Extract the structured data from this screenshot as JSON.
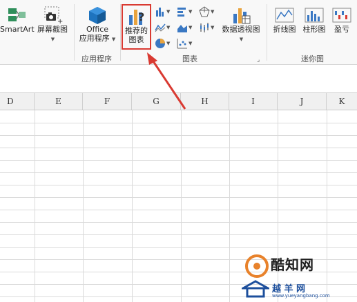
{
  "ribbon": {
    "smartart_label": "SmartArt",
    "screenshot_label": "屏幕截图",
    "office_apps_line1": "Office",
    "office_apps_line2": "应用程序",
    "group_apps_label": "应用程序",
    "recommended_charts_line1": "推荐的",
    "recommended_charts_line2": "图表",
    "pivot_chart_label": "数据透视图",
    "group_charts_label": "图表",
    "spark_line_label": "折线图",
    "spark_column_label": "柱形图",
    "spark_winloss_label": "盈亏",
    "group_sparklines_label": "迷你图"
  },
  "columns": [
    "D",
    "E",
    "F",
    "G",
    "H",
    "I",
    "J",
    "K"
  ],
  "watermark": {
    "brand1": "酷知网",
    "brand2": "越 羊 网",
    "url": "www.yueyangbang.com"
  },
  "colors": {
    "highlight": "#d93a32",
    "accent_blue": "#2b6cb0"
  },
  "icons": [
    "smartart-icon",
    "camera-icon",
    "office-cube-icon",
    "recommended-chart-icon",
    "pivot-chart-icon",
    "sparkline-icon"
  ]
}
